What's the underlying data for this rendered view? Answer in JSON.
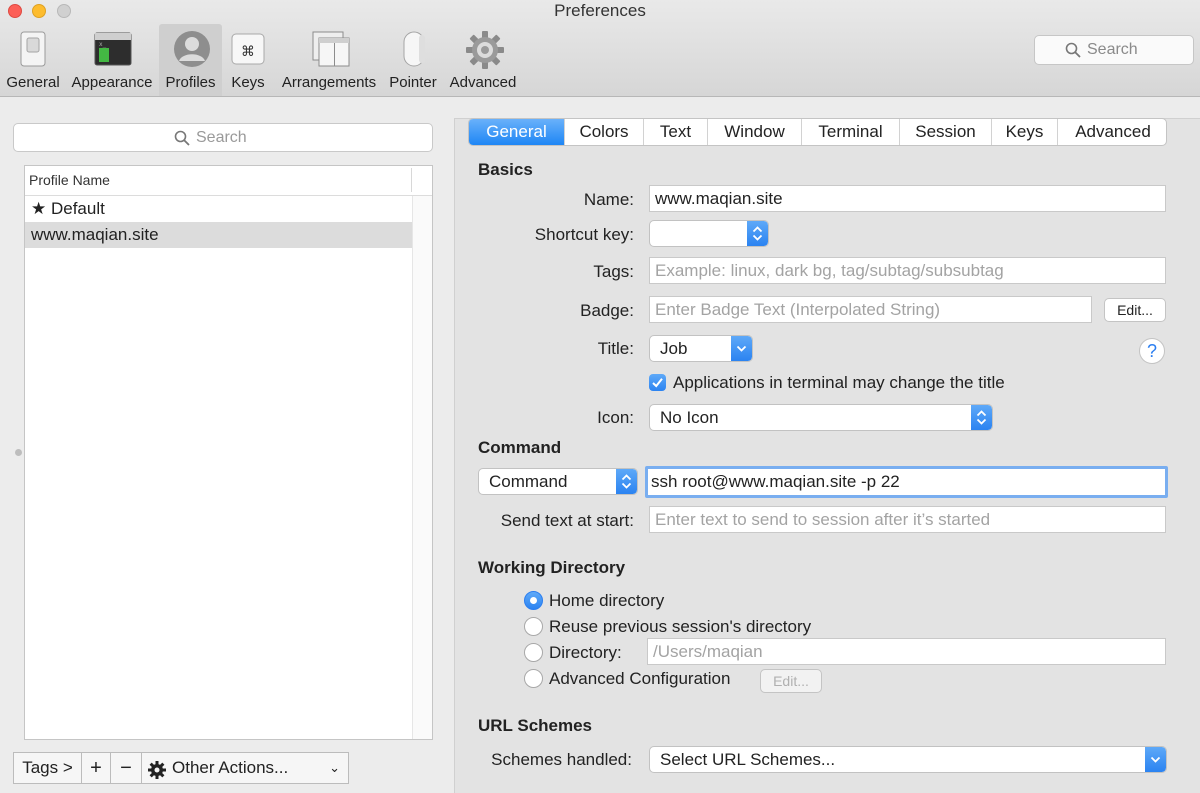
{
  "window": {
    "title": "Preferences"
  },
  "toolbar": {
    "items": [
      {
        "label": "General",
        "icon": "general-switch-icon"
      },
      {
        "label": "Appearance",
        "icon": "appearance-window-icon"
      },
      {
        "label": "Profiles",
        "icon": "profiles-user-icon",
        "active": true
      },
      {
        "label": "Keys",
        "icon": "keys-command-icon"
      },
      {
        "label": "Arrangements",
        "icon": "arrangements-windows-icon"
      },
      {
        "label": "Pointer",
        "icon": "pointer-mouse-icon"
      },
      {
        "label": "Advanced",
        "icon": "advanced-gear-icon"
      }
    ],
    "search_placeholder": "Search"
  },
  "profiles": {
    "search_placeholder": "Search",
    "column_header": "Profile Name",
    "rows": [
      {
        "name": "★ Default",
        "selected": false
      },
      {
        "name": "www.maqian.site",
        "selected": true
      }
    ],
    "bottom": {
      "tags": "Tags >",
      "add": "+",
      "remove": "−",
      "other_actions": "Other Actions...",
      "other_actions_chevron": "⌄"
    }
  },
  "tabs": [
    "General",
    "Colors",
    "Text",
    "Window",
    "Terminal",
    "Session",
    "Keys",
    "Advanced"
  ],
  "active_tab": "General",
  "basics": {
    "heading": "Basics",
    "name_label": "Name:",
    "name_value": "www.maqian.site",
    "shortcut_label": "Shortcut key:",
    "shortcut_value": "",
    "tags_label": "Tags:",
    "tags_placeholder": "Example: linux, dark bg, tag/subtag/subsubtag",
    "badge_label": "Badge:",
    "badge_placeholder": "Enter Badge Text (Interpolated String)",
    "badge_edit": "Edit...",
    "title_label": "Title:",
    "title_value": "Job",
    "help": "?",
    "apps_change_title": "Applications in terminal may change the title",
    "apps_change_title_checked": true,
    "icon_label": "Icon:",
    "icon_value": "No Icon"
  },
  "command": {
    "heading": "Command",
    "type_value": "Command",
    "command_value": "ssh root@www.maqian.site -p 22",
    "send_text_label": "Send text at start:",
    "send_text_placeholder": "Enter text to send to session after it’s started"
  },
  "working_directory": {
    "heading": "Working Directory",
    "options": [
      {
        "label": "Home directory",
        "selected": true
      },
      {
        "label": "Reuse previous session's directory",
        "selected": false
      },
      {
        "label": "Directory:",
        "selected": false
      },
      {
        "label": "Advanced Configuration",
        "selected": false
      }
    ],
    "directory_placeholder": "/Users/maqian",
    "advanced_edit": "Edit..."
  },
  "url_schemes": {
    "heading": "URL Schemes",
    "label": "Schemes handled:",
    "value": "Select URL Schemes..."
  },
  "colors": {
    "accent": "#1e86f5",
    "close": "#fc5f57",
    "minimize": "#fdbc2e",
    "zoom": "#d0d0d0"
  }
}
